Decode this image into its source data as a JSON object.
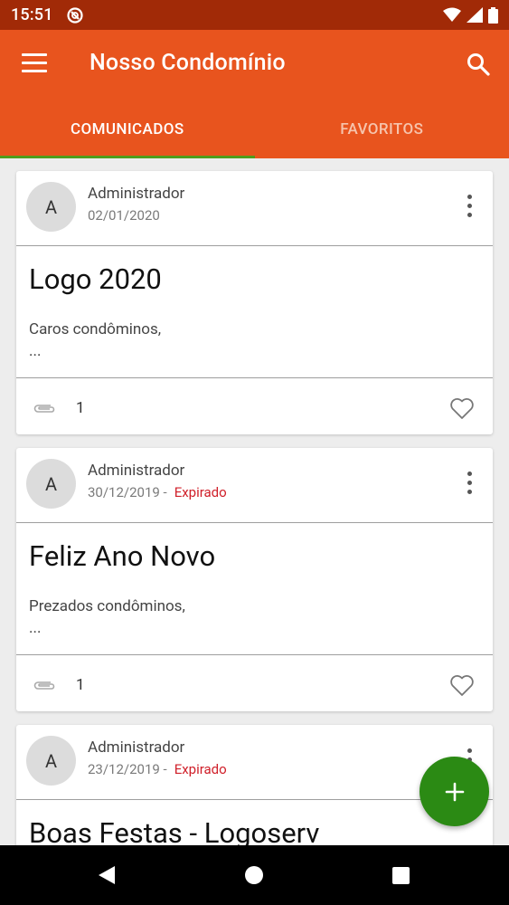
{
  "status_bar": {
    "time": "15:51"
  },
  "app_bar": {
    "title": "Nosso Condomínio",
    "tabs": [
      {
        "label": "COMUNICADOS",
        "active": true
      },
      {
        "label": "FAVORITOS",
        "active": false
      }
    ]
  },
  "posts": [
    {
      "avatar_letter": "A",
      "author": "Administrador",
      "date": "02/01/2020",
      "expired_label": "",
      "title": "Logo 2020",
      "excerpt_line1": "Caros condôminos,",
      "excerpt_line2": "...",
      "attachments": "1"
    },
    {
      "avatar_letter": "A",
      "author": "Administrador",
      "date": "30/12/2019 -",
      "expired_label": "Expirado",
      "title": "Feliz Ano Novo",
      "excerpt_line1": "Prezados condôminos,",
      "excerpt_line2": "...",
      "attachments": "1"
    },
    {
      "avatar_letter": "A",
      "author": "Administrador",
      "date": "23/12/2019 -",
      "expired_label": "Expirado",
      "title": "Boas Festas - Logoserv"
    }
  ],
  "colors": {
    "status_bar": "#a12a07",
    "app_bar": "#e8541e",
    "tab_indicator": "#4f9c1c",
    "fab": "#2b8a14",
    "expired": "#d0202a"
  },
  "icons": {
    "menu": "menu-icon",
    "search": "search-icon",
    "more": "more-vert-icon",
    "attachment": "paperclip-icon",
    "favorite": "heart-outline-icon",
    "fab": "plus-icon"
  }
}
